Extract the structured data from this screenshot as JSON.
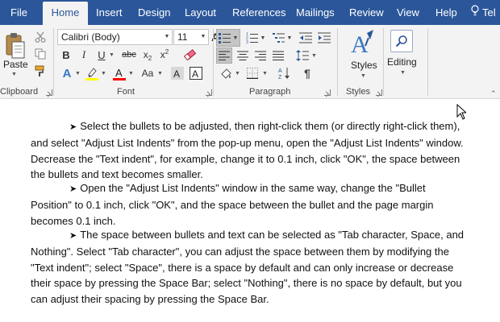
{
  "menu": {
    "tabs": [
      "File",
      "Home",
      "Insert",
      "Design",
      "Layout",
      "References",
      "Mailings",
      "Review",
      "View",
      "Help",
      "Tel"
    ],
    "active": "Home"
  },
  "ribbon": {
    "clipboard": {
      "label": "Clipboard",
      "paste_label": "Paste"
    },
    "font": {
      "label": "Font",
      "font_name": "Calibri (Body)",
      "font_size": "11",
      "bold": "B",
      "italic": "I",
      "underline": "U",
      "strike": "abc",
      "sub": "x",
      "sup": "x",
      "sub_n": "2",
      "sup_n": "2",
      "effects": "A",
      "case": "Aa",
      "grow": "A",
      "shrink": "A"
    },
    "paragraph": {
      "label": "Paragraph"
    },
    "styles": {
      "label": "Styles",
      "button_label": "Styles"
    },
    "editing": {
      "label": "Editing"
    }
  },
  "colors": {
    "brand": "#2b579a",
    "highlight": "#ffff00",
    "font_color": "#ff0000",
    "effects_blue": "#3a77c4"
  },
  "document": {
    "paragraphs": [
      "Select the bullets to be adjusted, then right-click them (or directly right-click them), and select \"Adjust List Indents\" from the pop-up menu, open the \"Adjust List Indents\" window. Decrease the \"Text indent\", for example, change it to 0.1 inch, click \"OK\", the space between the bullets and text becomes smaller.",
      "Open the \"Adjust List Indents\" window in the same way, change the \"Bullet Position\" to 0.1 inch, click \"OK\", and the space between the bullet and the page margin becomes 0.1 inch.",
      "The space between bullets and text can be selected as \"Tab character, Space, and Nothing\". Select \"Tab character\", you can adjust the space between them by modifying the \"Text indent\"; select \"Space\", there is a space by default and can only increase or decrease their space by pressing the Space Bar; select \"Nothing\", there is no space by default, but you can adjust their spacing by pressing the Space Bar."
    ],
    "bullet_glyph": "➤"
  }
}
